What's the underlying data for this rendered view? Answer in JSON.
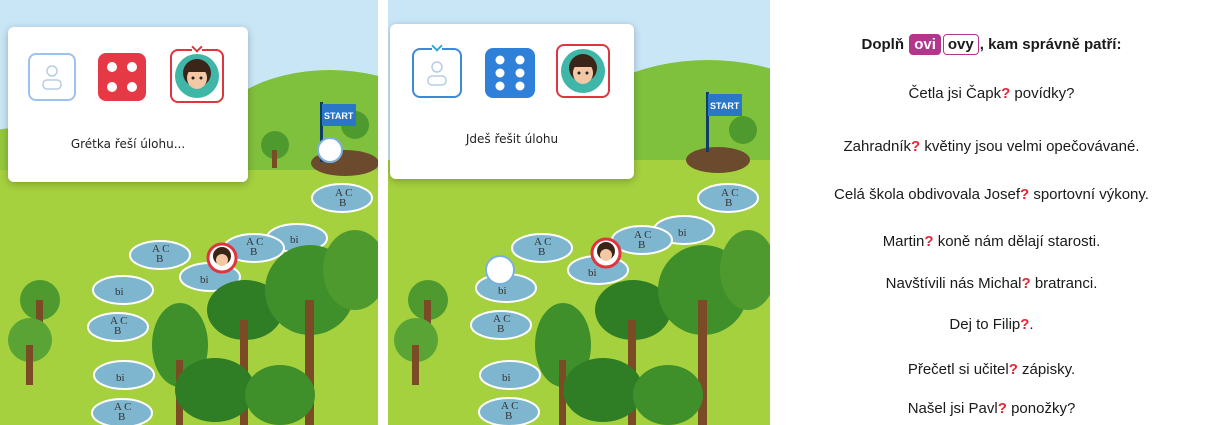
{
  "left_panel": {
    "status": "Grétka řeší úlohu...",
    "die_face": 4,
    "die_color": "#e63946",
    "flag_label": "START",
    "spaces": [
      "A C\nB",
      "bi",
      "A C\nB",
      "A C\nB",
      "bi",
      "bi",
      "A C\nB",
      "bi",
      "A C\nB",
      "A C\nB",
      "bi"
    ]
  },
  "middle_panel": {
    "status": "Jdeš řešit úlohu",
    "die_face": 6,
    "die_color": "#2f80d8",
    "flag_label": "START",
    "spaces": [
      "A C\nB",
      "bi",
      "A C\nB",
      "A C\nB",
      "bi",
      "bi",
      "A C\nB",
      "bi",
      "A C\nB",
      "A C\nB",
      "bi"
    ]
  },
  "task": {
    "prefix": "Doplň",
    "option_1": "ovi",
    "option_2": "ovy",
    "suffix": ", kam správně patří:",
    "gap": "?",
    "sentences": [
      {
        "before": "Četla jsi Čapk",
        "after": " povídky?"
      },
      {
        "before": "Zahradník",
        "after": " květiny jsou velmi opečovávané."
      },
      {
        "before": "Celá škola obdivovala Josef",
        "after": " sportovní výkony."
      },
      {
        "before": "Martin",
        "after": " koně nám dělají starosti."
      },
      {
        "before": "Navštívili nás Michal",
        "after": " bratranci."
      },
      {
        "before": "Dej to Filip",
        "after": "."
      },
      {
        "before": "Přečetl si učitel",
        "after": " zápisky."
      },
      {
        "before": "Našel jsi Pavl",
        "after": " ponožky?"
      }
    ]
  },
  "colors": {
    "accent_magenta": "#b3368c",
    "question_red": "#e32636",
    "sky": "#c9e6f7",
    "grass": "#a6d13f",
    "board_space": "#7fb6cf"
  }
}
